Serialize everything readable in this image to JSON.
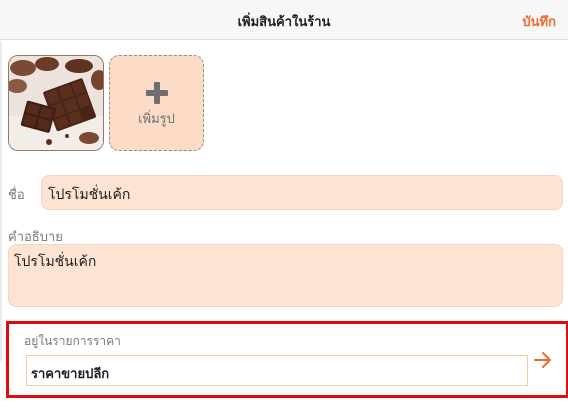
{
  "header": {
    "title": "เพิ่มสินค้าในร้าน",
    "save_label": "บันทึก"
  },
  "images": {
    "photo_icon": "product-photo",
    "add_photo_label": "เพิ่มรูป"
  },
  "form": {
    "name_label": "ชื่อ",
    "name_value": "โปรโมชั่นเค้ก",
    "description_label": "คำอธิบาย",
    "description_value": "โปรโมชั่นเค้ก"
  },
  "price_list": {
    "label": "อยู่ในรายการราคา",
    "selected_value": "ราคาขายปลีก"
  },
  "colors": {
    "accent": "#ee6a2e",
    "field_bg": "#fde3d1",
    "highlight_border": "#e20a0a"
  }
}
